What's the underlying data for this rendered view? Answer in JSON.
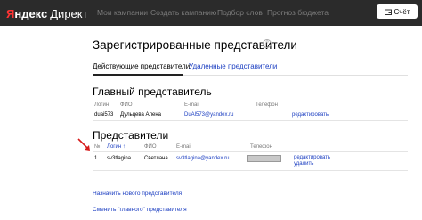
{
  "header": {
    "logo_ya": "Я",
    "logo_rest": "ндекс",
    "logo_product": "Директ",
    "nav": [
      "Мои кампании",
      "Создать кампанию",
      "Подбор слов",
      "Прогноз бюджета"
    ],
    "account_label": "Счёт"
  },
  "page": {
    "title": "Зарегистрированные представители",
    "tabs": [
      {
        "label": "Действующие представители",
        "active": true
      },
      {
        "label": "Удаленные представители",
        "active": false
      }
    ]
  },
  "main_rep": {
    "title": "Главный представитель",
    "columns": [
      "Логин",
      "ФИО",
      "E-mail",
      "Телефон"
    ],
    "row": {
      "login": "duai573",
      "name": "Дульцева Алена",
      "email": "DuAl573@yandex.ru",
      "phone": "",
      "action": "редактировать"
    }
  },
  "reps": {
    "title": "Представители",
    "columns": [
      "№",
      "Логин ↑",
      "ФИО",
      "E-mail",
      "Телефон"
    ],
    "rows": [
      {
        "num": "1",
        "login": "sv3tlagina",
        "name": "Светлана",
        "email": "sv3tlagina@yandex.ru",
        "actions": [
          "редактировать",
          "удалить"
        ]
      }
    ]
  },
  "links": {
    "assign_new": "Назначить нового представителя",
    "change_main": "Сменить \"главного\" представителя"
  }
}
